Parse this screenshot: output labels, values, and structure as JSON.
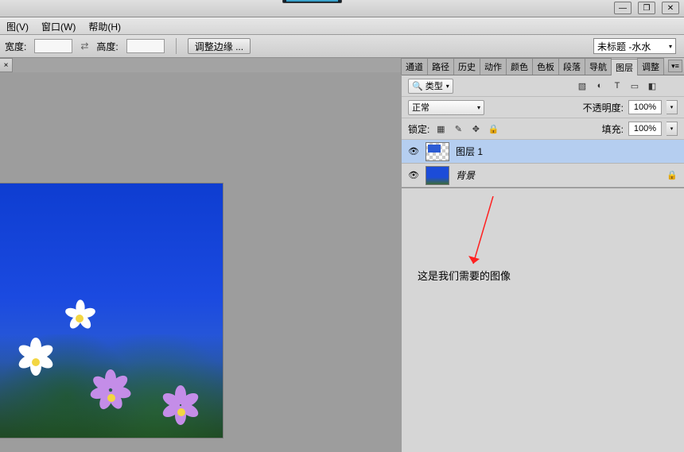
{
  "titlebar": {
    "tab_indicator": ""
  },
  "menubar": {
    "items": [
      "图(V)",
      "窗口(W)",
      "帮助(H)"
    ]
  },
  "optbar": {
    "width_label": "宽度:",
    "height_label": "高度:",
    "width_value": "",
    "height_value": "",
    "refine_edge": "调整边缘 ...",
    "doc_name": "未标题 -水水"
  },
  "panel_tabs": [
    "通道",
    "路径",
    "历史",
    "动作",
    "颜色",
    "色板",
    "段落",
    "导航",
    "图层",
    "调整"
  ],
  "active_tab_index": 8,
  "layers_panel": {
    "type_label": "类型",
    "blend_mode": "正常",
    "opacity_label": "不透明度:",
    "opacity_value": "100%",
    "lock_label": "锁定:",
    "fill_label": "填充:",
    "fill_value": "100%",
    "layers": [
      {
        "name": "图层 1",
        "visible": true,
        "selected": true,
        "locked": false
      },
      {
        "name": "背景",
        "visible": true,
        "selected": false,
        "locked": true
      }
    ]
  },
  "annotation": "这是我们需要的图像",
  "doc_tab_close": "×"
}
